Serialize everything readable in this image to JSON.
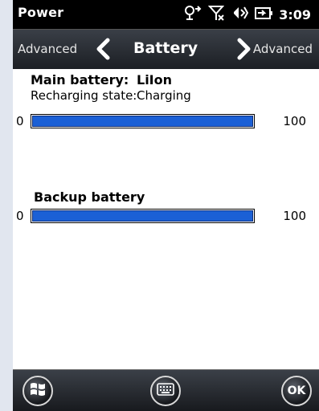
{
  "status_bar": {
    "title": "Power",
    "time": "3:09",
    "icons": [
      "connection-icon",
      "signal-off-icon",
      "speaker-icon",
      "battery-charging-icon"
    ]
  },
  "tab_bar": {
    "left_label": "Advanced",
    "title": "Battery",
    "right_label": "Advanced"
  },
  "main_battery": {
    "label": "Main battery:",
    "type": "LiIon",
    "recharge_label": "Recharging state:",
    "recharge_value": "Charging",
    "min": "0",
    "max": "100",
    "level_percent": 100
  },
  "backup_battery": {
    "label": "Backup battery",
    "min": "0",
    "max": "100",
    "level_percent": 100
  },
  "bottom_bar": {
    "ok_label": "OK",
    "icons": [
      "windows-start-icon",
      "keyboard-icon"
    ]
  }
}
